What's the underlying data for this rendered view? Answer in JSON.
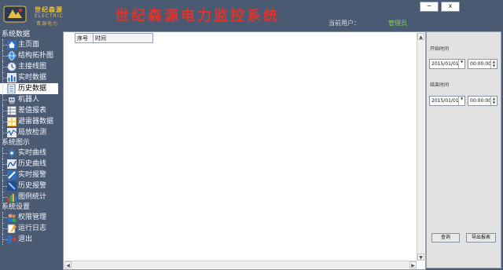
{
  "logo": {
    "cn": "世纪森源",
    "en": "ELECTRIC",
    "cn2": "青源电力"
  },
  "app": {
    "title": "世纪森源电力监控系统",
    "user_label": "当前用户：",
    "user_name": "管理员"
  },
  "window": {
    "minimize": "−",
    "close": "x"
  },
  "sidebar": {
    "groups": [
      {
        "label": "系统数据",
        "items": [
          {
            "label": "主页面",
            "icon": "home-icon"
          },
          {
            "label": "结构拓扑图",
            "icon": "globe-icon"
          },
          {
            "label": "主接线图",
            "icon": "clock-icon"
          },
          {
            "label": "实时数据",
            "icon": "bar-chart-icon"
          },
          {
            "label": "历史数据",
            "icon": "document-icon",
            "active": true
          },
          {
            "label": "机器人",
            "icon": "robot-icon"
          },
          {
            "label": "差值报表",
            "icon": "table-icon"
          },
          {
            "label": "避雷器数据",
            "icon": "grid-icon"
          },
          {
            "label": "局放检测",
            "icon": "wave-icon"
          }
        ]
      },
      {
        "label": "系统图示",
        "items": [
          {
            "label": "实时曲线",
            "icon": "gear-icon"
          },
          {
            "label": "历史曲线",
            "icon": "curve-icon"
          },
          {
            "label": "实时报警",
            "icon": "alarm-icon"
          },
          {
            "label": "历史报警",
            "icon": "alarm-history-icon"
          },
          {
            "label": "图例统计",
            "icon": "stats-icon"
          }
        ]
      },
      {
        "label": "系统设置",
        "items": [
          {
            "label": "权限管理",
            "icon": "users-icon"
          },
          {
            "label": "运行日志",
            "icon": "log-icon"
          },
          {
            "label": "退出",
            "icon": "exit-icon"
          }
        ]
      }
    ]
  },
  "table": {
    "columns": [
      "序号",
      "时间"
    ]
  },
  "filter": {
    "start_label": "开始时间",
    "end_label": "结束时间",
    "start_date": "2015/01/01",
    "start_time": "00:00:00",
    "end_date": "2015/01/01",
    "end_time": "00:00:00",
    "query_button": "查询",
    "export_button": "导出报表"
  },
  "colors": {
    "title_red": "#e0332a",
    "user_green": "#7fd34a",
    "sidebar_bg": "#4a5a72"
  }
}
